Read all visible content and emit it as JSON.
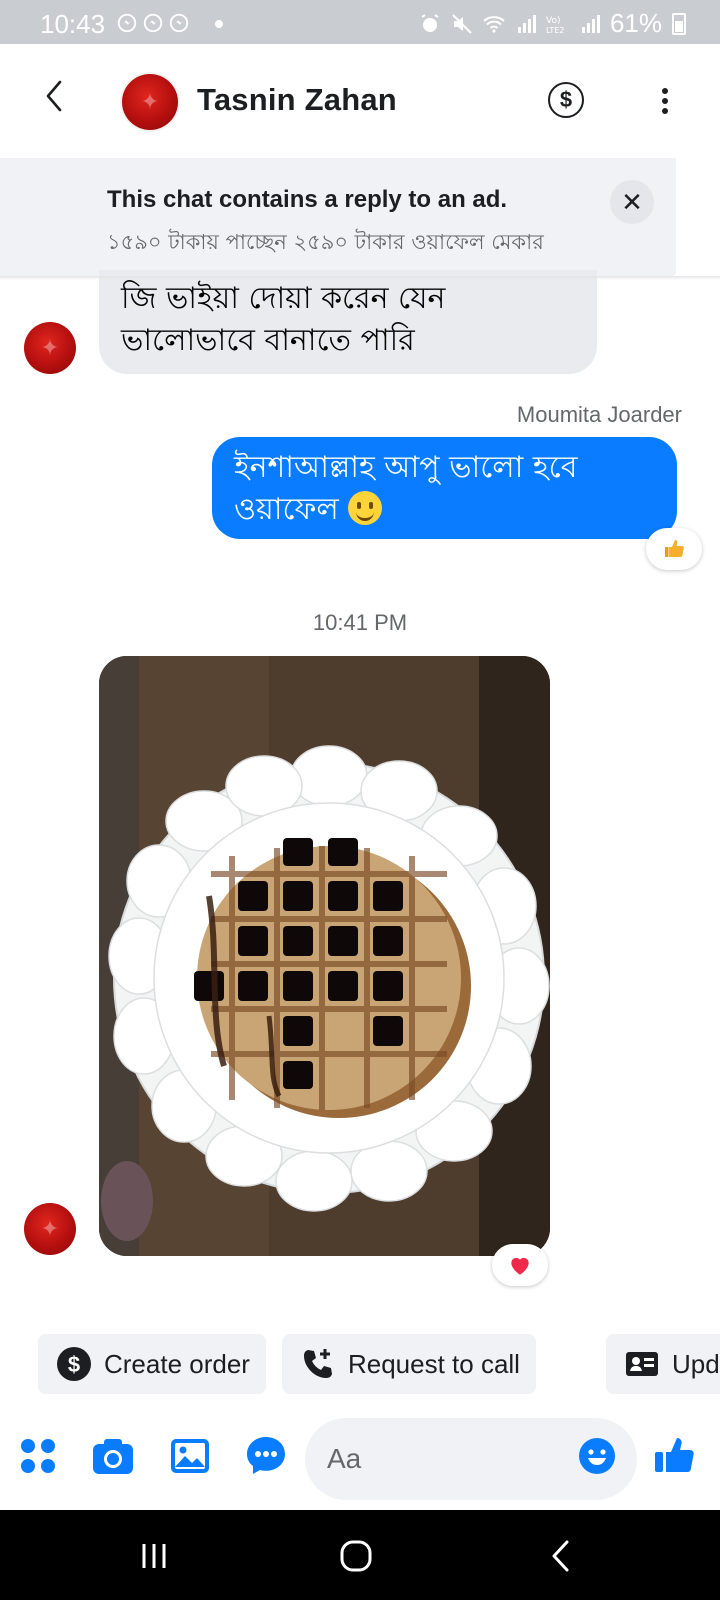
{
  "status_bar": {
    "time": "10:43",
    "battery": "61%"
  },
  "header": {
    "contact_name": "Tasnin Zahan"
  },
  "ad_banner": {
    "title": "This chat contains a reply to an ad.",
    "subtitle": "১৫৯০ টাকায় পাচ্ছেন ২৫৯০ টাকার ওয়াফেল মেকার"
  },
  "messages": {
    "incoming_1": "জি ভাইয়া দোয়া করেন যেন ভালোভাবে বানাতে পারি",
    "sender_name": "Moumita Joarder",
    "outgoing_1": "ইনশাআল্লাহ আপু ভালো হবে ওয়াফেল",
    "timestamp": "10:41 PM"
  },
  "quick_actions": [
    {
      "label": "Create order",
      "icon": "dollar-circle-icon"
    },
    {
      "label": "Request to call",
      "icon": "phone-plus-icon"
    },
    {
      "label": "Upd",
      "icon": "id-card-icon"
    }
  ],
  "composer": {
    "placeholder": "Aa"
  },
  "colors": {
    "accent": "#0a7cff",
    "bubble_incoming": "#e9ebee",
    "avatar_red": "#c4161c"
  }
}
